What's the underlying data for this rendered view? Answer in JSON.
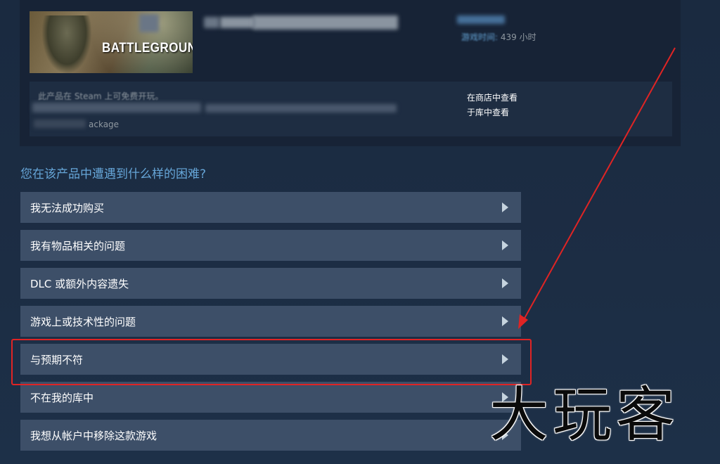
{
  "product": {
    "logo_text": "BATTLEGROUNDS",
    "playtime_label": "游戏时间:",
    "playtime_value": "439 小时",
    "license_note": "此产品在 Steam 上可免费开玩。",
    "package_text": "ackage",
    "view_in_store": "在商店中查看",
    "view_in_library": "于库中查看"
  },
  "question": "您在该产品中遭遇到什么样的困难?",
  "options": [
    {
      "label": "我无法成功购买"
    },
    {
      "label": "我有物品相关的问题"
    },
    {
      "label": "DLC 或额外内容遗失"
    },
    {
      "label": "游戏上或技术性的问题"
    },
    {
      "label": "与预期不符"
    },
    {
      "label": "不在我的库中"
    },
    {
      "label": "我想从帐户中移除这款游戏"
    }
  ],
  "highlighted_option_index": 4,
  "watermark": "大玩客",
  "colors": {
    "option_bg": "#3d4f68",
    "accent_blue": "#66a6d8",
    "annotation_red": "#e02424"
  }
}
